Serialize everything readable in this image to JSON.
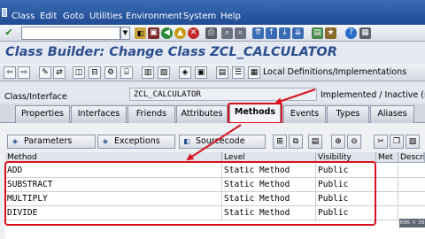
{
  "menubar": {
    "items": [
      "Class",
      "Edit",
      "Goto",
      "Utilities",
      "Environment",
      "System",
      "Help"
    ]
  },
  "toolbar": {
    "command_value": ""
  },
  "title": "Class Builder: Change Class ZCL_CALCULATOR",
  "app_toolbar": {
    "local_definitions_label": "Local Definitions/Implementations"
  },
  "class_interface": {
    "label": "Class/Interface",
    "value": "ZCL_CALCULATOR",
    "status": "Implemented / Inactive (r"
  },
  "tabs": [
    {
      "label": "Properties",
      "active": false
    },
    {
      "label": "Interfaces",
      "active": false
    },
    {
      "label": "Friends",
      "active": false
    },
    {
      "label": "Attributes",
      "active": false
    },
    {
      "label": "Methods",
      "active": true
    },
    {
      "label": "Events",
      "active": false
    },
    {
      "label": "Types",
      "active": false
    },
    {
      "label": "Aliases",
      "active": false
    }
  ],
  "methods_toolbar": {
    "parameters_label": "Parameters",
    "exceptions_label": "Exceptions",
    "sourcecode_label": "Sourcecode"
  },
  "grid": {
    "columns": [
      "Method",
      "Level",
      "Visibility",
      "Met",
      "Descri"
    ],
    "rows": [
      {
        "method": "ADD",
        "level": "Static Method",
        "visibility": "Public"
      },
      {
        "method": "SUBSTRACT",
        "level": "Static Method",
        "visibility": "Public"
      },
      {
        "method": "MULTIPLY",
        "level": "Static Method",
        "visibility": "Public"
      },
      {
        "method": "DIVIDE",
        "level": "Static Method",
        "visibility": "Public"
      }
    ]
  },
  "size_badge": "696 × 36",
  "colors": {
    "title_blue": "#2a4e8e",
    "annotation_red": "#d8121d",
    "menubar_blue": "#204c94"
  }
}
